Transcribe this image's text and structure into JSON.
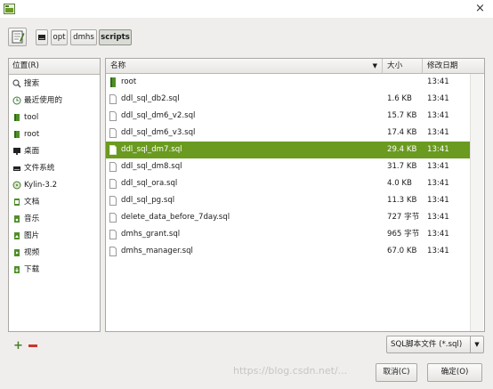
{
  "window": {
    "close_glyph": "×"
  },
  "path_bar": {
    "segments": [
      "opt",
      "dmhs",
      "scripts"
    ]
  },
  "places": {
    "header": "位置(R)",
    "items": [
      {
        "label": "搜索",
        "icon": "search-icon"
      },
      {
        "label": "最近使用的",
        "icon": "recent-icon"
      },
      {
        "label": "tool",
        "icon": "folder-icon"
      },
      {
        "label": "root",
        "icon": "home-folder-icon"
      },
      {
        "label": "桌面",
        "icon": "desktop-icon"
      },
      {
        "label": "文件系统",
        "icon": "drive-icon"
      },
      {
        "label": "Kylin-3.2",
        "icon": "disc-icon"
      },
      {
        "label": "文档",
        "icon": "documents-icon"
      },
      {
        "label": "音乐",
        "icon": "music-icon"
      },
      {
        "label": "图片",
        "icon": "pictures-icon"
      },
      {
        "label": "视频",
        "icon": "videos-icon"
      },
      {
        "label": "下载",
        "icon": "downloads-icon"
      }
    ]
  },
  "files": {
    "columns": {
      "name": "名称",
      "size": "大小",
      "modified": "修改日期"
    },
    "rows": [
      {
        "name": "root",
        "size": "",
        "modified": "13:41",
        "type": "folder"
      },
      {
        "name": "ddl_sql_db2.sql",
        "size": "1.6 KB",
        "modified": "13:41",
        "type": "file"
      },
      {
        "name": "ddl_sql_dm6_v2.sql",
        "size": "15.7 KB",
        "modified": "13:41",
        "type": "file"
      },
      {
        "name": "ddl_sql_dm6_v3.sql",
        "size": "17.4 KB",
        "modified": "13:41",
        "type": "file"
      },
      {
        "name": "ddl_sql_dm7.sql",
        "size": "29.4 KB",
        "modified": "13:41",
        "type": "file",
        "selected": true
      },
      {
        "name": "ddl_sql_dm8.sql",
        "size": "31.7 KB",
        "modified": "13:41",
        "type": "file"
      },
      {
        "name": "ddl_sql_ora.sql",
        "size": "4.0 KB",
        "modified": "13:41",
        "type": "file"
      },
      {
        "name": "ddl_sql_pg.sql",
        "size": "11.3 KB",
        "modified": "13:41",
        "type": "file"
      },
      {
        "name": "delete_data_before_7day.sql",
        "size": "727 字节",
        "modified": "13:41",
        "type": "file"
      },
      {
        "name": "dmhs_grant.sql",
        "size": "965 字节",
        "modified": "13:41",
        "type": "file"
      },
      {
        "name": "dmhs_manager.sql",
        "size": "67.0 KB",
        "modified": "13:41",
        "type": "file"
      }
    ]
  },
  "filter": {
    "value": "SQL脚本文件 (*.sql)"
  },
  "buttons": {
    "cancel": "取消(C)",
    "ok": "确定(O)"
  },
  "watermark": "https://blog.csdn.net/...",
  "colors": {
    "selection": "#6a9a1f",
    "accent": "#4a7d2a"
  }
}
